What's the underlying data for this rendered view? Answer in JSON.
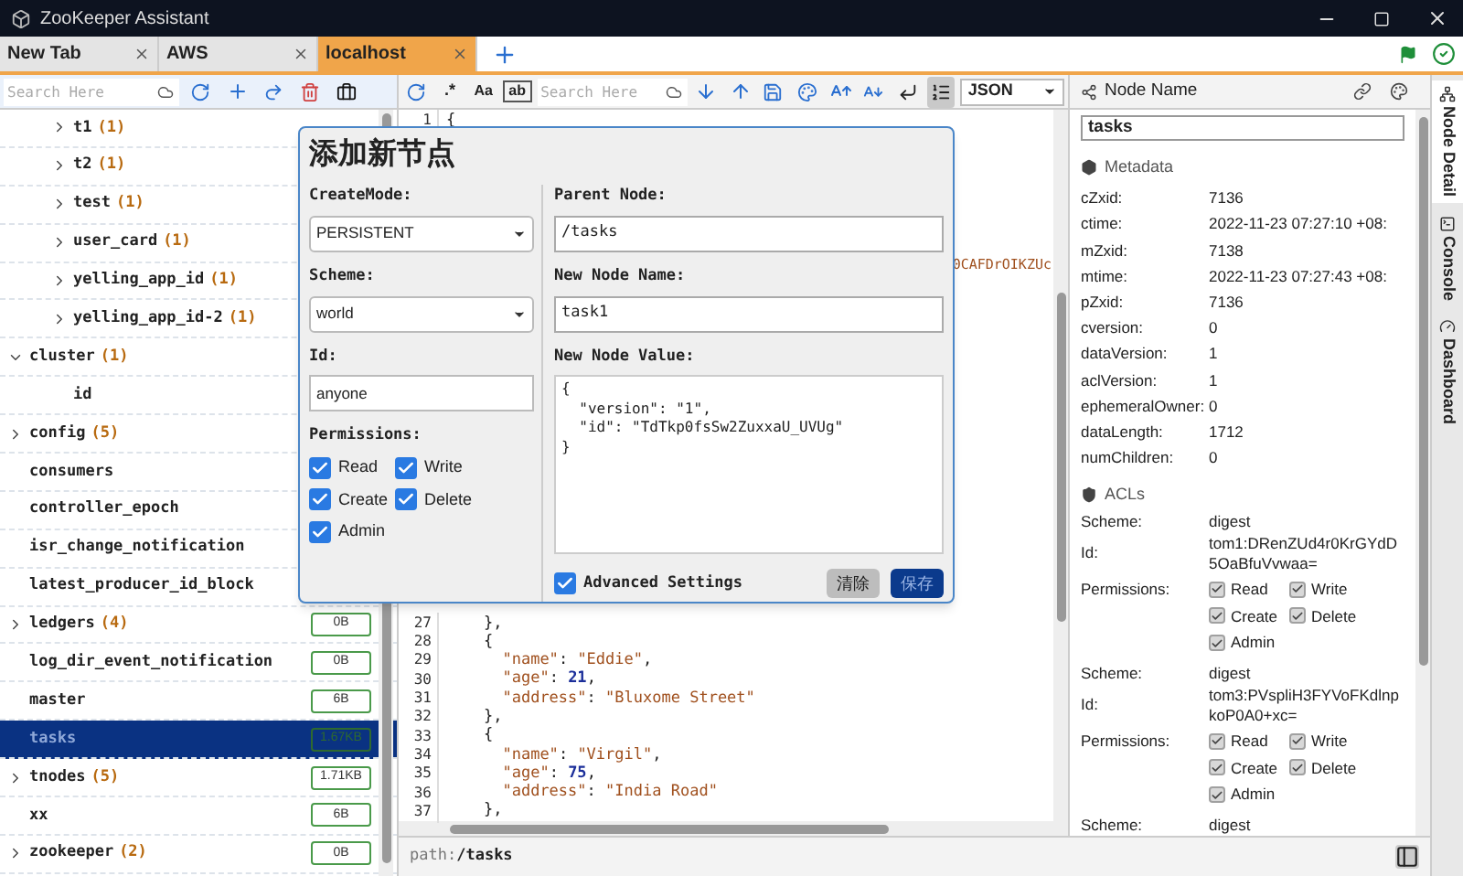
{
  "window": {
    "title": "ZooKeeper Assistant"
  },
  "tabs": [
    {
      "label": "New Tab",
      "selected": false
    },
    {
      "label": "AWS",
      "selected": false
    },
    {
      "label": "localhost",
      "selected": true
    }
  ],
  "tree_search": {
    "placeholder": "Search Here"
  },
  "tree": [
    {
      "children": [
        {
          "label": "t1",
          "count": "(1)",
          "expanded": false,
          "selected": false
        },
        {
          "label": "t2",
          "count": "(1)",
          "expanded": false,
          "selected": false
        },
        {
          "label": "test",
          "count": "(1)",
          "expanded": false,
          "selected": false
        },
        {
          "label": "user_card",
          "count": "(1)",
          "expanded": false,
          "selected": false
        },
        {
          "label": "yelling_app_id",
          "count": "(1)",
          "expanded": false,
          "selected": false
        },
        {
          "label": "yelling_app_id-2",
          "count": "(1)",
          "expanded": false,
          "selected": false
        }
      ]
    },
    {
      "label": "cluster",
      "count": "(1)",
      "expanded": true,
      "selected": false,
      "children": [
        {
          "label": "id",
          "selected": false
        }
      ]
    },
    {
      "label": "config",
      "count": "(5)",
      "expanded": false,
      "selected": false
    },
    {
      "label": "consumers",
      "selected": false
    },
    {
      "label": "controller_epoch",
      "selected": false
    },
    {
      "label": "isr_change_notification",
      "selected": false
    },
    {
      "label": "latest_producer_id_block",
      "selected": false
    },
    {
      "label": "ledgers",
      "count": "(4)",
      "expanded": false,
      "selected": false,
      "size": "0B"
    },
    {
      "label": "log_dir_event_notification",
      "selected": false,
      "size": "0B"
    },
    {
      "label": "master",
      "selected": false,
      "size": "6B"
    },
    {
      "label": "tasks",
      "selected": true,
      "size": "1.67KB"
    },
    {
      "label": "tnodes",
      "count": "(5)",
      "expanded": false,
      "selected": false,
      "size": "1.71KB"
    },
    {
      "label": "xx",
      "selected": false,
      "size": "6B"
    },
    {
      "label": "zookeeper",
      "count": "(2)",
      "expanded": false,
      "selected": false,
      "size": "0B"
    }
  ],
  "editor_toolbar": {
    "regex": ".*",
    "match_case": "Aa",
    "whole_word": "ab",
    "search_placeholder": "Search Here",
    "list_view_on": true,
    "format": "JSON"
  },
  "editor": {
    "top_lines": [
      {
        "number": "1",
        "text": "{"
      }
    ],
    "partial_line": "0CAFDrOIKZUc",
    "lines": [
      {
        "number": "27",
        "text": "    },"
      },
      {
        "number": "28",
        "text": "    {"
      },
      {
        "number": "29",
        "text": "      \"name\": \"Eddie\","
      },
      {
        "number": "30",
        "text": "      \"age\": 21,"
      },
      {
        "number": "31",
        "text": "      \"address\": \"Bluxome Street\""
      },
      {
        "number": "32",
        "text": "    },"
      },
      {
        "number": "33",
        "text": "    {"
      },
      {
        "number": "34",
        "text": "      \"name\": \"Virgil\","
      },
      {
        "number": "35",
        "text": "      \"age\": 75,"
      },
      {
        "number": "36",
        "text": "      \"address\": \"India Road\""
      },
      {
        "number": "37",
        "text": "    },"
      }
    ]
  },
  "path_bar": {
    "label": "path:",
    "value": "/tasks"
  },
  "node_panel": {
    "title": "Node Name",
    "value": "tasks",
    "metadata_title": "Metadata",
    "metadata": [
      {
        "key": "cZxid:",
        "value": "7136"
      },
      {
        "key": "ctime:",
        "value": "2022-11-23 07:27:10 +08:"
      },
      {
        "key": "mZxid:",
        "value": "7138"
      },
      {
        "key": "mtime:",
        "value": "2022-11-23 07:27:43 +08:"
      },
      {
        "key": "pZxid:",
        "value": "7136"
      },
      {
        "key": "cversion:",
        "value": "0"
      },
      {
        "key": "dataVersion:",
        "value": "1"
      },
      {
        "key": "aclVersion:",
        "value": "1"
      },
      {
        "key": "ephemeralOwner:",
        "value": "0"
      },
      {
        "key": "dataLength:",
        "value": "1712"
      },
      {
        "key": "numChildren:",
        "value": "0"
      }
    ],
    "acls_title": "ACLs",
    "acls": [
      {
        "scheme_label": "Scheme:",
        "scheme": "digest",
        "id_label": "Id:",
        "id": "tom1:DRenZUd4r0KrGYdD5OaBfuVvwaa=",
        "permissions_label": "Permissions:",
        "permissions": [
          {
            "label": "Read",
            "checked": true
          },
          {
            "label": "Write",
            "checked": true
          },
          {
            "label": "Create",
            "checked": true
          },
          {
            "label": "Delete",
            "checked": true
          },
          {
            "label": "Admin",
            "checked": true
          }
        ]
      },
      {
        "scheme_label": "Scheme:",
        "scheme": "digest",
        "id_label": "Id:",
        "id": "tom3:PVspliH3FYVoFKdlnpkoP0A0+xc=",
        "permissions_label": "Permissions:",
        "permissions": [
          {
            "label": "Read",
            "checked": true
          },
          {
            "label": "Write",
            "checked": true
          },
          {
            "label": "Create",
            "checked": true
          },
          {
            "label": "Delete",
            "checked": true
          },
          {
            "label": "Admin",
            "checked": true
          }
        ]
      },
      {
        "scheme_label": "Scheme:",
        "scheme": "digest"
      }
    ]
  },
  "side_tabs": [
    {
      "label": "Node Detail",
      "selected": true
    },
    {
      "label": "Console",
      "selected": false
    },
    {
      "label": "Dashboard",
      "selected": false
    }
  ],
  "dialog": {
    "title": "添加新节点",
    "create_mode": {
      "label": "CreateMode:",
      "value": "PERSISTENT"
    },
    "scheme": {
      "label": "Scheme:",
      "value": "world"
    },
    "id": {
      "label": "Id:",
      "value": "anyone"
    },
    "permissions_label": "Permissions:",
    "permissions": [
      {
        "label": "Read",
        "checked": true
      },
      {
        "label": "Write",
        "checked": true
      },
      {
        "label": "Create",
        "checked": true
      },
      {
        "label": "Delete",
        "checked": true
      },
      {
        "label": "Admin",
        "checked": true
      }
    ],
    "parent_node": {
      "label": "Parent Node:",
      "value": "/tasks"
    },
    "node_name": {
      "label": "New Node Name:",
      "value": "task1"
    },
    "node_value": {
      "label": "New Node Value:",
      "value": "{\n  \"version\": \"1\",\n  \"id\": \"TdTkp0fsSw2ZuxxaU_UVUg\"\n}"
    },
    "advanced": {
      "label": "Advanced Settings",
      "checked": true
    },
    "buttons": [
      {
        "label": "清除",
        "kind": "secondary"
      },
      {
        "label": "保存",
        "kind": "primary"
      }
    ]
  }
}
